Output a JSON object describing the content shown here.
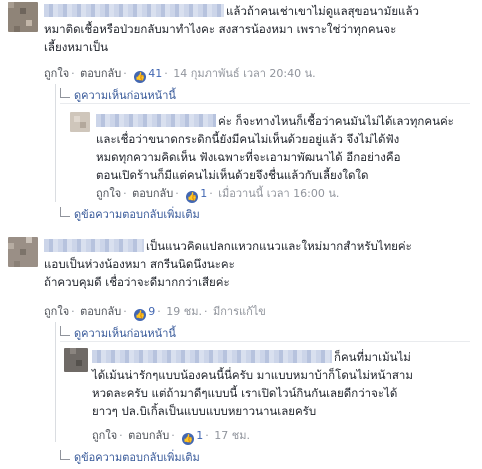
{
  "comments": [
    {
      "text_lines": [
        "แล้วถ้าคนเช่าเขาไม่ดูแลสุขอนามัยแล้ว",
        "หมาติดเชื้อหรือป่วยกลับมาทำไงคะ สงสารน้องหมา เพราะใช่ว่าทุกคนจะ",
        "เลี้ยงหมาเป็น"
      ],
      "like": "ถูกใจ",
      "reply": "ตอบกลับ",
      "like_count": "41",
      "time": "14 กุมภาพันธ์ เวลา 20:40 น."
    },
    {
      "text_lines": [
        "ค่ะ ก็จะทางไหนก็เชื้อว่าคนมันไม่ได้เลวทุกคนค่ะ",
        "และเชื่อว่าขนาดกระดิกนี้ยังมีคนไม่เห็นด้วยอยู่แล้ว จึงไม่ได้ฟัง",
        "หมดทุกความคิดเห็น ฟังเฉพาะที่จะเอามาพัฒนาได้ อีกอย่างคือ",
        "ตอนเปิดร้านก็มีแต่คนไม่เห็นด้วยจึงชื่นแล้วกับเลี้ยงใดใด"
      ],
      "like": "ถูกใจ",
      "reply": "ตอบกลับ",
      "like_count": "1",
      "time": "เมื่อวานนี้ เวลา 16:00 น."
    },
    {
      "text_lines": [
        "เป็นแนวคิดแปลกแหวกแนวและใหม่มากสำหรับไทยค่ะ",
        "แอบเป็นห่วงน้องหมา สกรีนนิดนึงนะคะ",
        "ถ้าควบคุมดี เชื่อว่าจะดีมากกว่าเสียค่ะ"
      ],
      "like": "ถูกใจ",
      "reply": "ตอบกลับ",
      "like_count": "9",
      "time": "19 ชม.",
      "edited": "มีการแก้ไข"
    },
    {
      "text_lines": [
        "ก็คนที่มาเม้นไม่",
        "ได้เม้นน่ารักๆแบบน้องคนนี้นี่ครับ มาแบบหมาบ้าก็โดนไม่หน้าสาม",
        "หวดละครับ แต่ถ้ามาดีๆแบบนี้ เราเปิดไวน์กินกันเลยดีกว่าจะได้",
        "ยาวๆ ปล.บิเกิ้ลเป็นแบบแบบหยาวนานเลยครับ"
      ],
      "like": "ถูกใจ",
      "reply": "ตอบกลับ",
      "like_count": "1",
      "time": "17 ชม."
    }
  ],
  "links": {
    "view_previous": "ดูความเห็นก่อนหน้านี้",
    "view_more_replies": "ดูข้อความตอบกลับเพิ่มเติม"
  },
  "icons": {
    "like": "thumbs-up-icon",
    "reply_arrow": "reply-arrow-icon"
  },
  "colors": {
    "link": "#365899",
    "meta": "#90949c",
    "like_badge": "#4267b2"
  }
}
